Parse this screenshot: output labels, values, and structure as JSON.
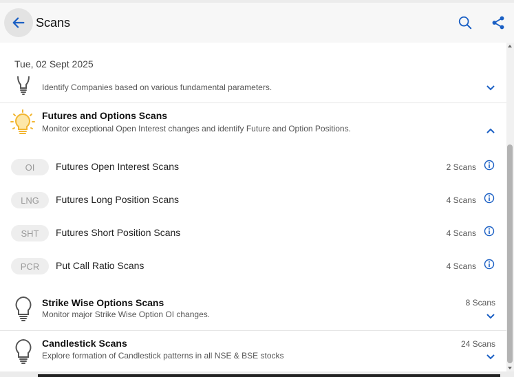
{
  "header": {
    "title": "Scans",
    "back_icon": "arrow-left-icon",
    "search_icon": "search-icon",
    "share_icon": "share-icon"
  },
  "date_label": "Tue, 02 Sept 2025",
  "categories": [
    {
      "icon": "bulb-icon",
      "title": "",
      "description": "Identify Companies based on various fundamental parameters.",
      "expanded": false
    },
    {
      "icon": "bulb-lit-icon",
      "title": "Futures and Options Scans",
      "description": "Monitor exceptional Open Interest changes and identify Future and Option Positions.",
      "expanded": true,
      "items": [
        {
          "tag": "OI",
          "label": "Futures Open Interest Scans",
          "count": "2 Scans"
        },
        {
          "tag": "LNG",
          "label": "Futures Long Position Scans",
          "count": "4 Scans"
        },
        {
          "tag": "SHT",
          "label": "Futures Short Position Scans",
          "count": "4 Scans"
        },
        {
          "tag": "PCR",
          "label": "Put Call Ratio Scans",
          "count": "4 Scans"
        }
      ]
    },
    {
      "icon": "bulb-icon",
      "title": "Strike Wise Options Scans",
      "description": "Monitor major Strike Wise Option OI changes.",
      "count": "8 Scans",
      "expanded": false
    },
    {
      "icon": "bulb-icon",
      "title": "Candlestick Scans",
      "description": "Explore formation of Candlestick patterns in all NSE & BSE stocks",
      "count": "24 Scans",
      "expanded": false
    }
  ],
  "colors": {
    "accent": "#1a5fc4",
    "bulb_lit": "#f2b632",
    "header_bg": "#f7f7f7"
  }
}
